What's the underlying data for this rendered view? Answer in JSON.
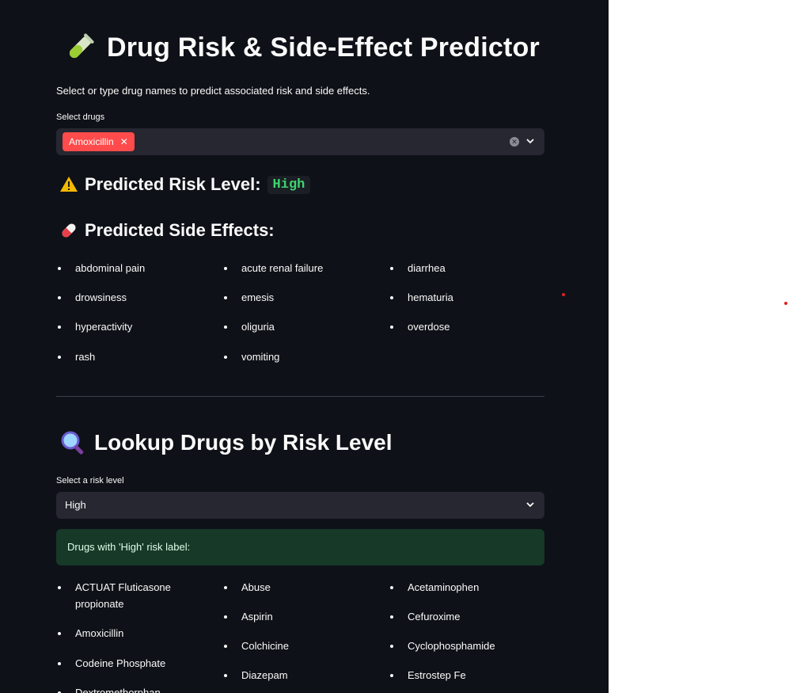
{
  "title": "Drug Risk & Side-Effect Predictor",
  "subtitle": "Select or type drug names to predict associated risk and side effects.",
  "drug_select": {
    "label": "Select drugs",
    "selected": [
      "Amoxicillin"
    ]
  },
  "risk": {
    "heading": "Predicted Risk Level:",
    "value": "High"
  },
  "side_effects": {
    "heading": "Predicted Side Effects:",
    "col1": [
      "abdominal pain",
      "drowsiness",
      "hyperactivity",
      "rash"
    ],
    "col2": [
      "acute renal failure",
      "emesis",
      "oliguria",
      "vomiting"
    ],
    "col3": [
      "diarrhea",
      "hematuria",
      "overdose"
    ]
  },
  "lookup": {
    "heading": "Lookup Drugs by Risk Level",
    "select_label": "Select a risk level",
    "selected_level": "High",
    "success_text": "Drugs with 'High' risk label:",
    "col1": [
      "ACTUAT Fluticasone propionate",
      "Amoxicillin",
      "Codeine Phosphate",
      "Dextromethorphan"
    ],
    "col2": [
      "Abuse",
      "Aspirin",
      "Colchicine",
      "Diazepam"
    ],
    "col3": [
      "Acetaminophen",
      "Cefuroxime",
      "Cyclophosphamide",
      "Estrostep Fe"
    ]
  },
  "icons": {
    "title": "test-tube-icon",
    "risk": "warning-icon",
    "side_effects": "pill-icon",
    "lookup": "magnifier-icon"
  }
}
